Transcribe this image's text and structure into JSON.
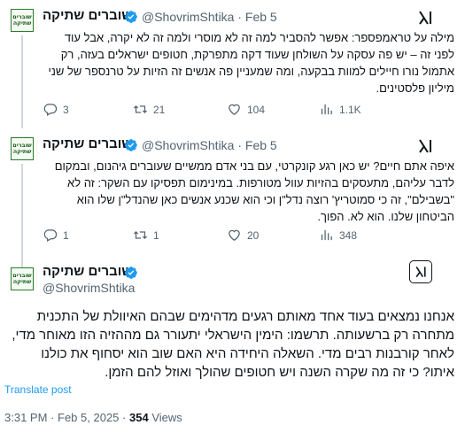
{
  "account": {
    "name": "שוברים שתיקה",
    "handle": "@ShovrimShtika",
    "avatar_text_line1": "שוברים",
    "avatar_text_line2": "שתיקה"
  },
  "colors": {
    "verified": "#1d9bf0",
    "link": "#1d9bf0",
    "secondary_text": "#536471",
    "avatar_green": "#2b7a2b"
  },
  "tweets": [
    {
      "date": "Feb 5",
      "separator": "·",
      "text": "מילה על טראמפספר: אפשר להסביר למה זה לא מוסרי ולמה זה לא יקרה, אבל עוד לפני זה – יש פה עסקה על השולחן שעוד דקה מתפרקת, חטופים ישראלים בעזה, רק אתמול נורו חיילים למוות בבקעה, ומה שמעניין פה אנשים זה הזיות על טרנספר של שני מיליון פלסטינים.",
      "replies": "3",
      "reposts": "21",
      "likes": "104",
      "views": "1.1K"
    },
    {
      "date": "Feb 5",
      "separator": "·",
      "text": "איפה אתם חיים? יש כאן רגע קונקרטי, עם בני אדם ממשיים שעוברים גיהנום, ובמקום לדבר עליהם, מתעסקים בהזיות עוול מטורפות. במינימום תפסיקו עם השקר: זה לא \"בשבילם\", זה כי סמוטריץ' רוצה נדל\"ן וכי הוא שכנע אנשים כאן שהנדל\"ן שלו הוא הביטחון שלנו. הוא לא. הפוך.",
      "replies": "1",
      "reposts": "1",
      "likes": "20",
      "views": "348"
    }
  ],
  "main_tweet": {
    "text": "אנחנו נמצאים בעוד אחד מאותם רגעים מדהימים שבהם האיוולת של התכנית מתחרה רק ברשעותה. תרשמו: הימין הישראלי יתעורר גם מההזיה הזו מאוחר מדי, לאחר קורבנות רבים מדי. השאלה היחידה היא האם שוב הוא יסחוף את כולנו איתו? כי זה מה שקרה השנה ויש חטופים שהולך ואוזל להם הזמן.",
    "translate_label": "Translate post",
    "time": "3:31 PM",
    "separator": "·",
    "date": "Feb 5, 2025",
    "separator2": "·",
    "views_count": "354",
    "views_label": "Views"
  },
  "icons": {
    "verified": "verified-badge-icon",
    "grok": "grok-icon",
    "reply": "reply-icon",
    "repost": "repost-icon",
    "like": "like-icon",
    "views": "views-icon"
  }
}
